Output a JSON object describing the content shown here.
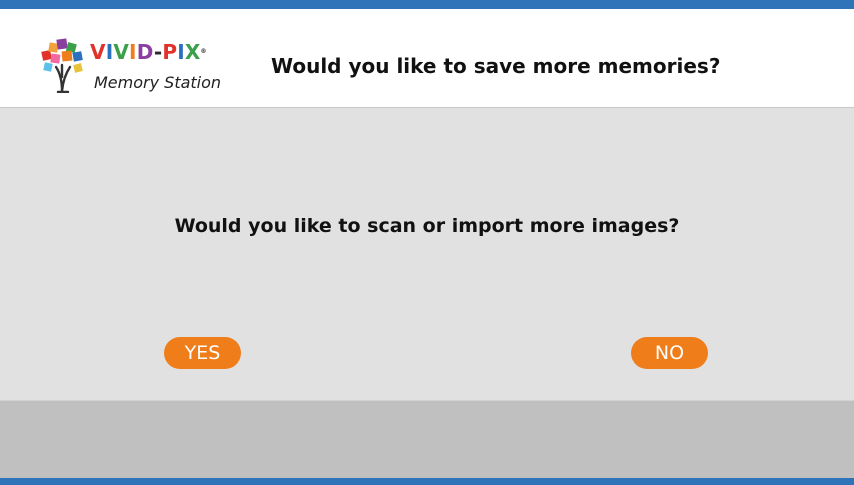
{
  "header": {
    "logo": {
      "brand_parts": [
        "V",
        "I",
        "V",
        "I",
        "D",
        "-",
        "P",
        "I",
        "X"
      ],
      "trademark": "®",
      "subtitle": "Memory Station"
    },
    "title": "Would you like to save more memories?"
  },
  "dialog": {
    "prompt": "Would you like to scan or import more images?",
    "yes_label": "YES",
    "no_label": "NO"
  },
  "colors": {
    "brand_blue": "#2f74b8",
    "button_orange": "#ef7d1a",
    "panel_gray": "#e1e1e1",
    "footer_gray": "#c0c0c0"
  }
}
